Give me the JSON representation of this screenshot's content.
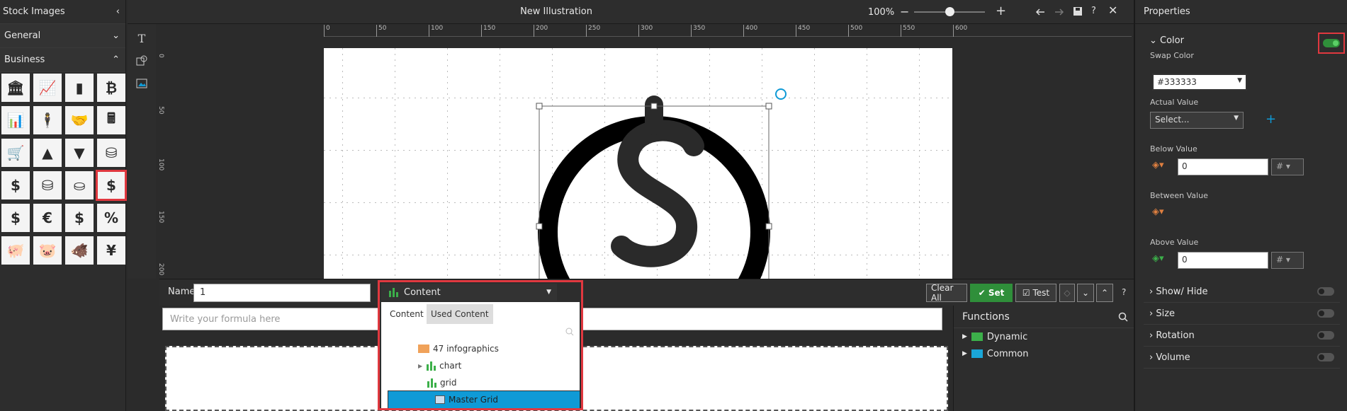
{
  "left_panel": {
    "title": "Stock Images",
    "sections": [
      {
        "label": "General",
        "expanded": false
      },
      {
        "label": "Business",
        "expanded": true
      }
    ],
    "icons": [
      "bank-icon",
      "line-chart-up-icon",
      "bar-chart-icon",
      "bitcoin-icon",
      "growth-chart-icon",
      "businessman-icon",
      "handshake-icon",
      "calculator-icon",
      "shopping-cart-icon",
      "bar-growth-icon",
      "bar-decline-icon",
      "coin-stack-icon",
      "money-chart-icon",
      "coin-stacks-icon",
      "database-coins-icon",
      "dollar-coin-icon",
      "dollar-black-coin-icon",
      "euro-coin-icon",
      "money-bag-icon",
      "percent-icon",
      "piggy-bank-icon",
      "piggy-coin-icon",
      "savings-icon",
      "yen-coin-icon"
    ],
    "icon_glyphs": [
      "🏛",
      "📈",
      "▮",
      "₿",
      "📊",
      "🕴",
      "🤝",
      "🖩",
      "🛒",
      "▲",
      "▼",
      "⛁",
      "$",
      "⛁",
      "⛀",
      "$",
      "$",
      "€",
      "$",
      "%",
      "🐖",
      "🐷",
      "🐗",
      "¥"
    ],
    "selected_index": 15
  },
  "toolbar": {
    "title": "New Illustration",
    "zoom": "100%",
    "zoom_out": "−",
    "zoom_in": "+",
    "slider_value": 0.5
  },
  "ruler": {
    "top_labels": [
      "0",
      "50",
      "100",
      "150",
      "200",
      "250",
      "300",
      "350",
      "400",
      "450",
      "500",
      "550",
      "600"
    ],
    "left_labels": [
      "0",
      "50",
      "100",
      "150",
      "200"
    ]
  },
  "formula_bar": {
    "name_label": "Name",
    "name_value": "1",
    "content_label": "Content",
    "clear_all": "Clear All",
    "set": "Set",
    "test": "Test",
    "help": "?"
  },
  "editor": {
    "placeholder": "Write your formula here"
  },
  "dropdown": {
    "tabs": [
      "Content",
      "Used Content"
    ],
    "active_tab": 0,
    "tree": [
      {
        "label": "47 infographics",
        "type": "folder"
      },
      {
        "label": "chart",
        "type": "chart"
      },
      {
        "label": "grid",
        "type": "chart"
      },
      {
        "label": "Master Grid",
        "type": "item",
        "selected": true
      }
    ]
  },
  "functions": {
    "title": "Functions",
    "items": [
      "Dynamic",
      "Common"
    ]
  },
  "properties": {
    "title": "Properties",
    "color_section": "Color",
    "color_enabled": true,
    "swap_color_label": "Swap Color",
    "swap_color_value": "#333333",
    "actual_value_label": "Actual Value",
    "actual_value_placeholder": "Select...",
    "below_value_label": "Below Value",
    "below_value": "0",
    "between_value_label": "Between Value",
    "above_value_label": "Above Value",
    "above_value": "0",
    "hash": "#",
    "sections": [
      "Show/ Hide",
      "Size",
      "Rotation",
      "Volume"
    ],
    "colors": {
      "accent_green": "#2f8f3a",
      "highlight_red": "#e0383f",
      "select_blue": "#0f9ad6"
    }
  }
}
